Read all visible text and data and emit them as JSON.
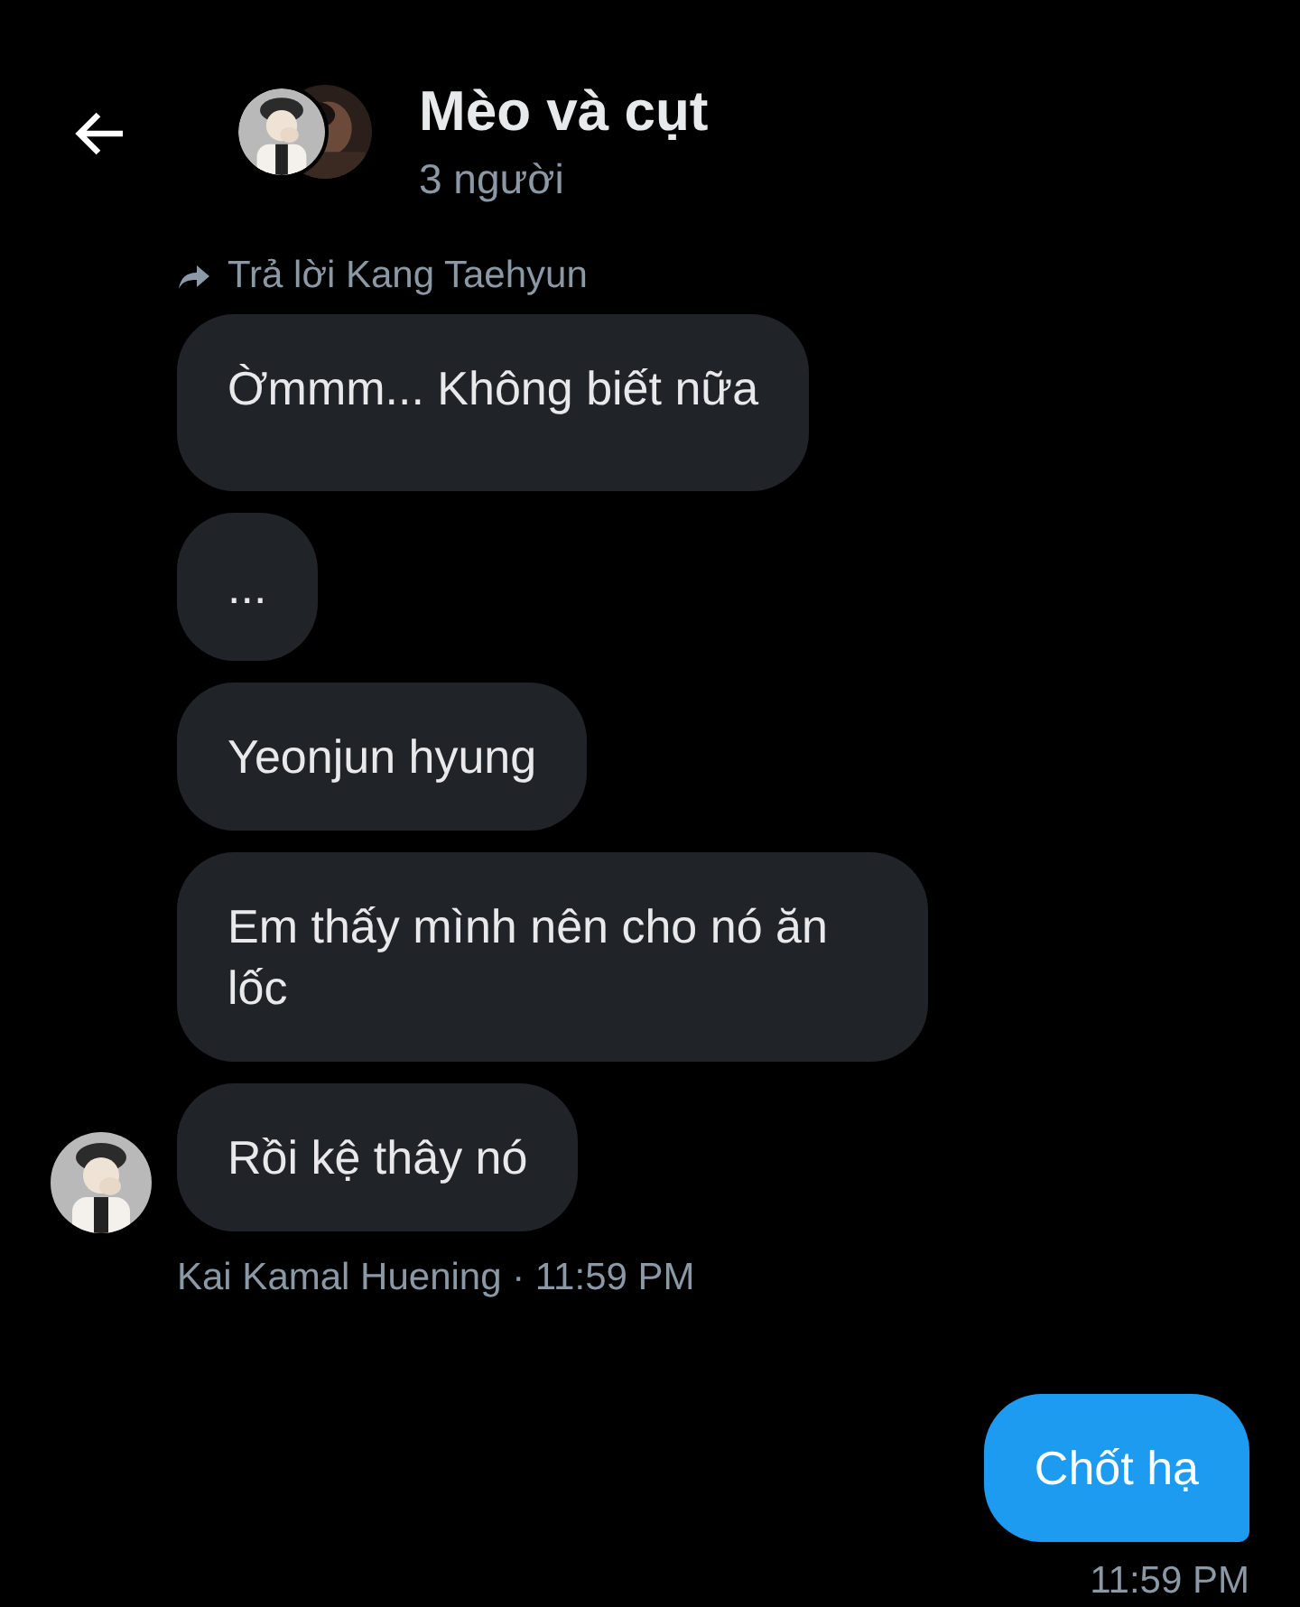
{
  "header": {
    "title": "Mèo và cụt",
    "subtitle": "3 người"
  },
  "items": [
    {
      "kind": "reply_label",
      "text": "Trả lời Kang Taehyun"
    },
    {
      "kind": "received",
      "text": "Ờmmm... Không biết nữa",
      "show_avatar": false,
      "tall": true
    },
    {
      "kind": "received",
      "text": "...",
      "show_avatar": false,
      "tall": false
    },
    {
      "kind": "received",
      "text": "Yeonjun hyung",
      "show_avatar": false,
      "tall": false
    },
    {
      "kind": "received",
      "text": "Em thấy mình nên cho nó ăn lốc",
      "show_avatar": false,
      "tall": false
    },
    {
      "kind": "received",
      "text": "Rồi kệ thây nó",
      "show_avatar": true,
      "tall": false
    },
    {
      "kind": "meta",
      "text": "Kai Kamal Huening · 11:59 PM"
    },
    {
      "kind": "sent",
      "text": "Chốt hạ"
    },
    {
      "kind": "time",
      "text": "11:59 PM"
    }
  ]
}
